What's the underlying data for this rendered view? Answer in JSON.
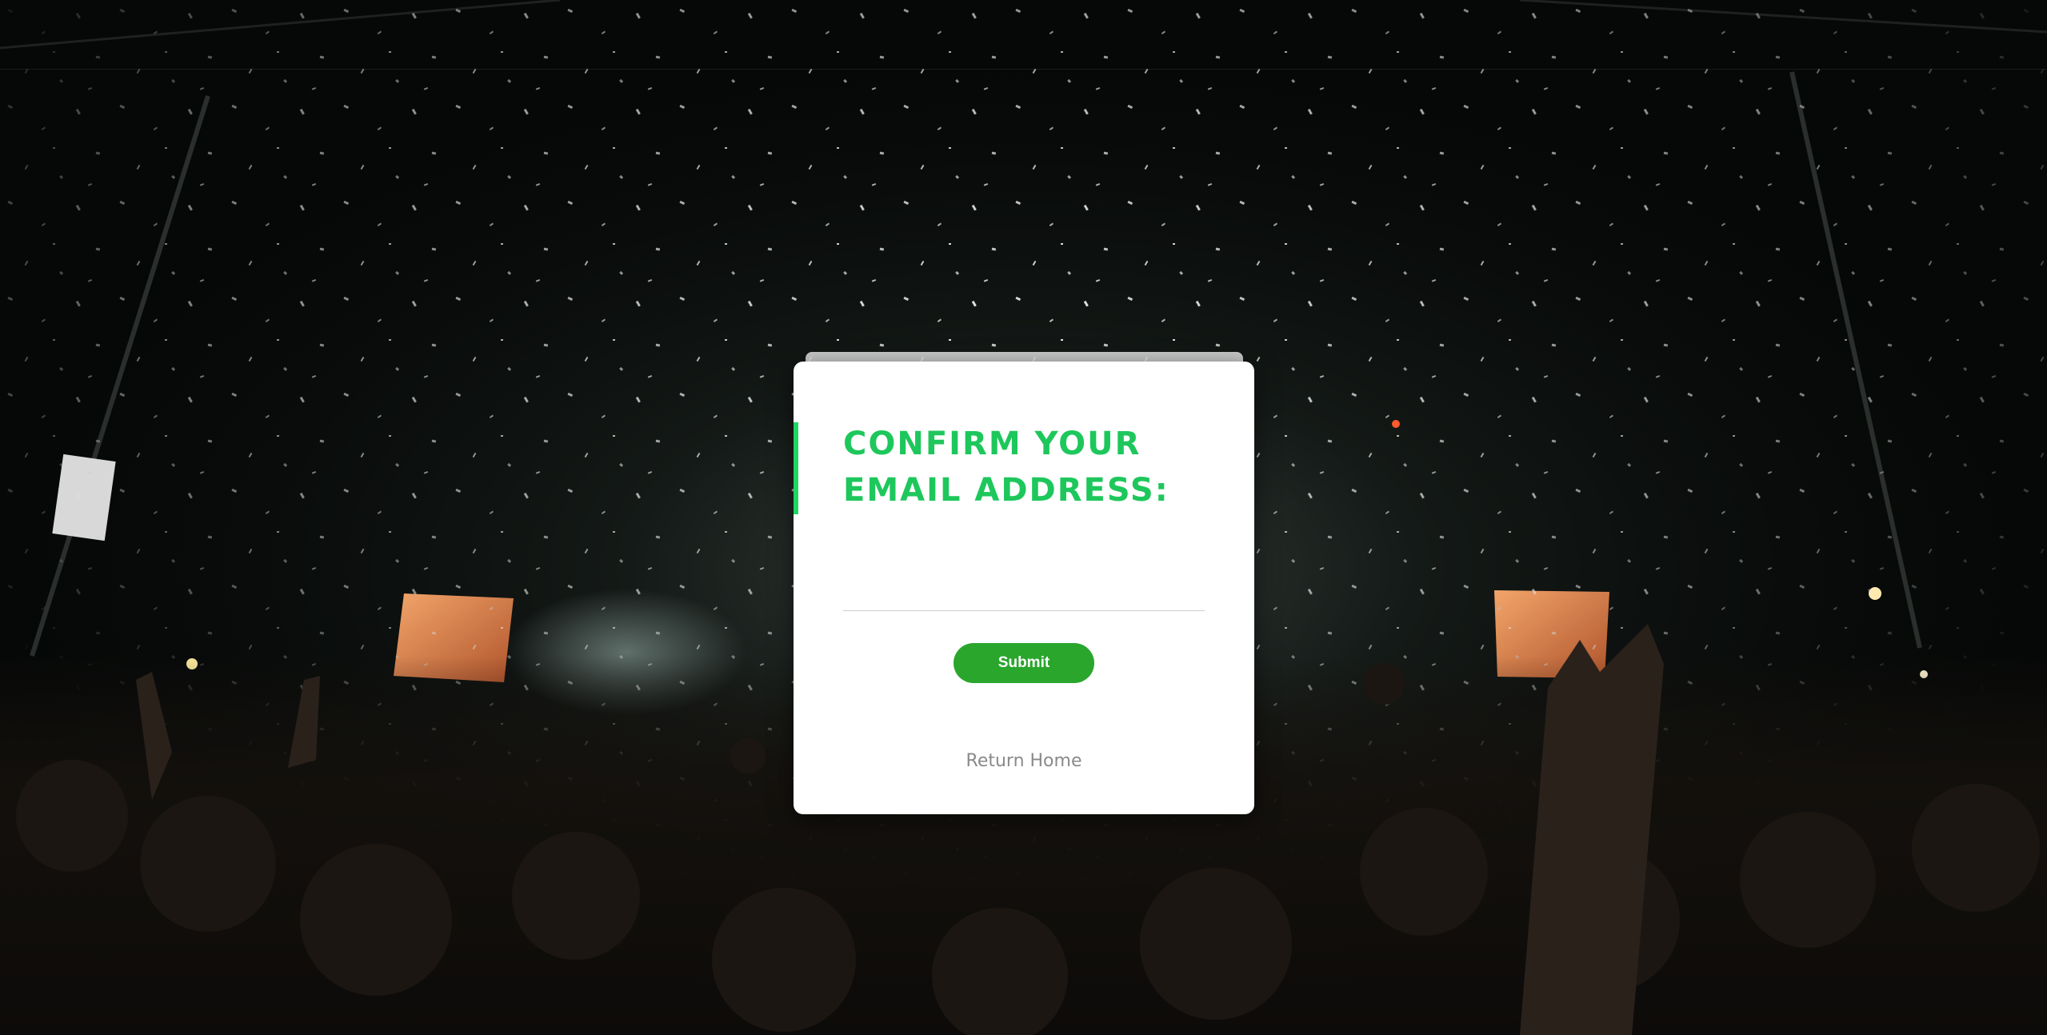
{
  "dialog": {
    "title": "CONFIRM YOUR EMAIL ADDRESS:",
    "email_value": "",
    "submit_label": "Submit",
    "return_label": "Return Home"
  },
  "colors": {
    "accent": "#1ed760",
    "title": "#1ec75c",
    "button": "#2aa62c",
    "link": "#8a8a8a",
    "card": "#ffffff"
  }
}
